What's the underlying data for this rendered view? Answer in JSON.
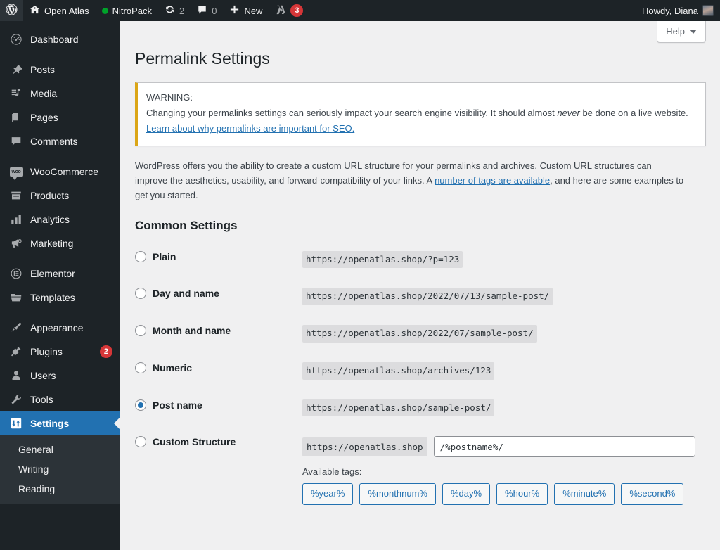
{
  "adminbar": {
    "logo_icon": "wordpress-logo-icon",
    "site_name": "Open Atlas",
    "site_icon": "home-icon",
    "nitropack": {
      "label": "NitroPack",
      "status_icon": "status-dot-green"
    },
    "updates": {
      "icon": "updates-icon",
      "count": "2"
    },
    "comments": {
      "icon": "comment-bubble-icon",
      "count": "0"
    },
    "new": {
      "icon": "plus-icon",
      "label": "New"
    },
    "yoast": {
      "icon": "yoast-icon",
      "count": "3"
    },
    "account": {
      "greeting": "Howdy, Diana",
      "avatar_icon": "user-avatar"
    }
  },
  "sidebar": {
    "items": [
      {
        "label": "Dashboard",
        "icon": "dashboard-icon",
        "key": "dashboard"
      },
      {
        "label": "Posts",
        "icon": "pin-icon",
        "key": "posts"
      },
      {
        "label": "Media",
        "icon": "media-icon",
        "key": "media"
      },
      {
        "label": "Pages",
        "icon": "pages-icon",
        "key": "pages"
      },
      {
        "label": "Comments",
        "icon": "comment-icon",
        "key": "comments"
      },
      {
        "label": "WooCommerce",
        "icon": "woocommerce-icon",
        "key": "woocommerce"
      },
      {
        "label": "Products",
        "icon": "products-icon",
        "key": "products"
      },
      {
        "label": "Analytics",
        "icon": "analytics-bars-icon",
        "key": "analytics"
      },
      {
        "label": "Marketing",
        "icon": "megaphone-icon",
        "key": "marketing"
      },
      {
        "label": "Elementor",
        "icon": "elementor-icon",
        "key": "elementor"
      },
      {
        "label": "Templates",
        "icon": "folder-icon",
        "key": "templates"
      },
      {
        "label": "Appearance",
        "icon": "paintbrush-icon",
        "key": "appearance"
      },
      {
        "label": "Plugins",
        "icon": "plugin-icon",
        "key": "plugins",
        "badge": "2"
      },
      {
        "label": "Users",
        "icon": "user-icon",
        "key": "users"
      },
      {
        "label": "Tools",
        "icon": "wrench-icon",
        "key": "tools"
      },
      {
        "label": "Settings",
        "icon": "settings-sliders-icon",
        "key": "settings",
        "current": true
      }
    ],
    "submenu": [
      {
        "label": "General"
      },
      {
        "label": "Writing"
      },
      {
        "label": "Reading"
      }
    ]
  },
  "help_tab": {
    "label": "Help",
    "icon": "caret-down-icon"
  },
  "page": {
    "title": "Permalink Settings",
    "warning": {
      "heading": "WARNING:",
      "body_before_em": "Changing your permalinks settings can seriously impact your search engine visibility. It should almost ",
      "em": "never",
      "body_after_em": " be done on a live website.",
      "link": "Learn about why permalinks are important for SEO."
    },
    "intro": {
      "part1": "WordPress offers you the ability to create a custom URL structure for your permalinks and archives. Custom URL structures can improve the aesthetics, usability, and forward-compatibility of your links. A ",
      "link": "number of tags are available",
      "part2": ", and here are some examples to get you started."
    },
    "common_settings_heading": "Common Settings",
    "options": [
      {
        "label": "Plain",
        "url": "https://openatlas.shop/?p=123",
        "selected": false
      },
      {
        "label": "Day and name",
        "url": "https://openatlas.shop/2022/07/13/sample-post/",
        "selected": false
      },
      {
        "label": "Month and name",
        "url": "https://openatlas.shop/2022/07/sample-post/",
        "selected": false
      },
      {
        "label": "Numeric",
        "url": "https://openatlas.shop/archives/123",
        "selected": false
      },
      {
        "label": "Post name",
        "url": "https://openatlas.shop/sample-post/",
        "selected": true
      }
    ],
    "custom": {
      "label": "Custom Structure",
      "selected": false,
      "prefix": "https://openatlas.shop",
      "value": "/%postname%/",
      "available_tags_label": "Available tags:",
      "tags": [
        "%year%",
        "%monthnum%",
        "%day%",
        "%hour%",
        "%minute%",
        "%second%"
      ]
    }
  },
  "colors": {
    "admin_dark": "#1d2327",
    "admin_dark2": "#2c3338",
    "accent_blue": "#2271b1",
    "warning_gold": "#dba617",
    "badge_red": "#d63638",
    "status_green": "#00a32a",
    "page_bg": "#f0f0f1",
    "code_bg": "#dcdcde"
  }
}
